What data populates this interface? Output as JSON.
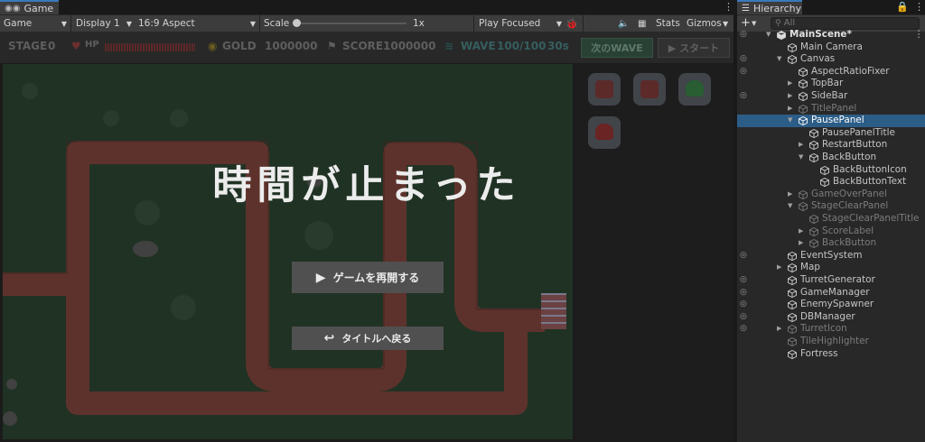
{
  "game_tab": {
    "label": "Game"
  },
  "game_toolbar": {
    "mode": "Game",
    "display": "Display 1",
    "aspect": "16:9 Aspect",
    "scale_label": "Scale",
    "scale_value": "1x",
    "play_mode": "Play Focused",
    "stats": "Stats",
    "gizmos": "Gizmos"
  },
  "hud": {
    "stage_label": "STAGE",
    "stage_value": "0",
    "hp_label": "HP",
    "gold_label": "GOLD",
    "gold_value": "1000000",
    "score_label": "SCORE",
    "score_value": "1000000",
    "wave_label": "WAVE",
    "wave_value": "100/100",
    "timer": "30s",
    "next_wave_label": "次のWAVE",
    "start_label": "スタート"
  },
  "pause": {
    "title": "時間が止まった",
    "resume_label": "ゲームを再開する",
    "back_label": "タイトルへ戻る"
  },
  "hierarchy": {
    "tab_label": "Hierarchy",
    "search_placeholder": "All",
    "items": [
      {
        "label": "MainScene*"
      },
      {
        "label": "Main Camera"
      },
      {
        "label": "Canvas"
      },
      {
        "label": "AspectRatioFixer"
      },
      {
        "label": "TopBar"
      },
      {
        "label": "SideBar"
      },
      {
        "label": "TitlePanel"
      },
      {
        "label": "PausePanel"
      },
      {
        "label": "PausePanelTitle"
      },
      {
        "label": "RestartButton"
      },
      {
        "label": "BackButton"
      },
      {
        "label": "BackButtonIcon"
      },
      {
        "label": "BackButtonText"
      },
      {
        "label": "GameOverPanel"
      },
      {
        "label": "StageClearPanel"
      },
      {
        "label": "StageClearPanelTitle"
      },
      {
        "label": "ScoreLabel"
      },
      {
        "label": "BackButton"
      },
      {
        "label": "EventSystem"
      },
      {
        "label": "Map"
      },
      {
        "label": "TurretGenerator"
      },
      {
        "label": "GameManager"
      },
      {
        "label": "EnemySpawner"
      },
      {
        "label": "DBManager"
      },
      {
        "label": "TurretIcon"
      },
      {
        "label": "TileHighlighter"
      },
      {
        "label": "Fortress"
      }
    ]
  },
  "colors": {
    "accent": "#3a79bb",
    "selection": "#2c5d87",
    "road": "#6b3a33",
    "grass": "#253a2a"
  }
}
